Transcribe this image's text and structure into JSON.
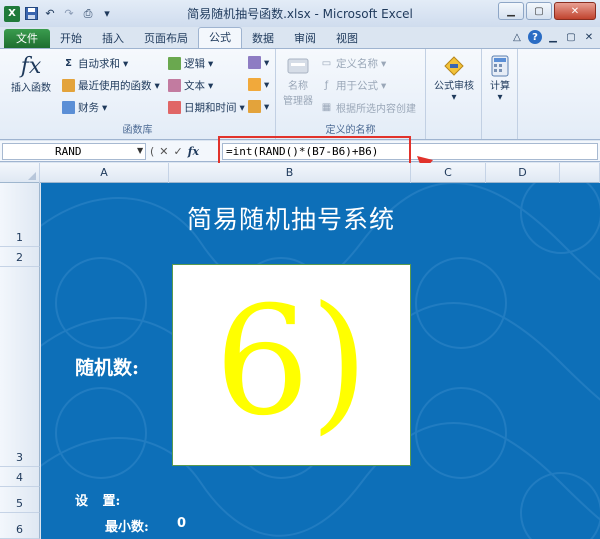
{
  "window": {
    "title": "简易随机抽号函数.xlsx - Microsoft Excel",
    "logo": "X"
  },
  "tabs": [
    {
      "label": "文件"
    },
    {
      "label": "开始"
    },
    {
      "label": "插入"
    },
    {
      "label": "页面布局"
    },
    {
      "label": "公式"
    },
    {
      "label": "数据"
    },
    {
      "label": "审阅"
    },
    {
      "label": "视图"
    }
  ],
  "ribbon": {
    "function_library": {
      "label": "函数库",
      "insert_function": "插入函数",
      "autosum": "自动求和",
      "recent": "最近使用的函数",
      "financial": "财务",
      "logical": "逻辑",
      "text": "文本",
      "datetime": "日期和时间"
    },
    "defined_names": {
      "label": "定义的名称",
      "name_manager_line1": "名称",
      "name_manager_line2": "管理器",
      "define_name": "定义名称",
      "use_in_formula": "用于公式",
      "create_from_selection": "根据所选内容创建"
    },
    "formula_auditing": {
      "label": "公式审核"
    },
    "calculation": {
      "label": "计算"
    }
  },
  "formula_bar": {
    "name_box": "RAND",
    "formula": "=int(RAND()*(B7-B6)+B6)"
  },
  "columns": [
    "A",
    "B",
    "C",
    "D"
  ],
  "rows": [
    "1",
    "2",
    "3",
    "4",
    "5",
    "6"
  ],
  "sheet": {
    "title": "简易随机抽号系统",
    "random_label": "随机数:",
    "result": "6)",
    "settings_label": "设 置:",
    "min_label": "最小数:",
    "min_value": "0"
  },
  "colors": {
    "sheet_background": "#0d6fb8",
    "result_text": "#ffff00",
    "highlight": "#e1322b"
  }
}
